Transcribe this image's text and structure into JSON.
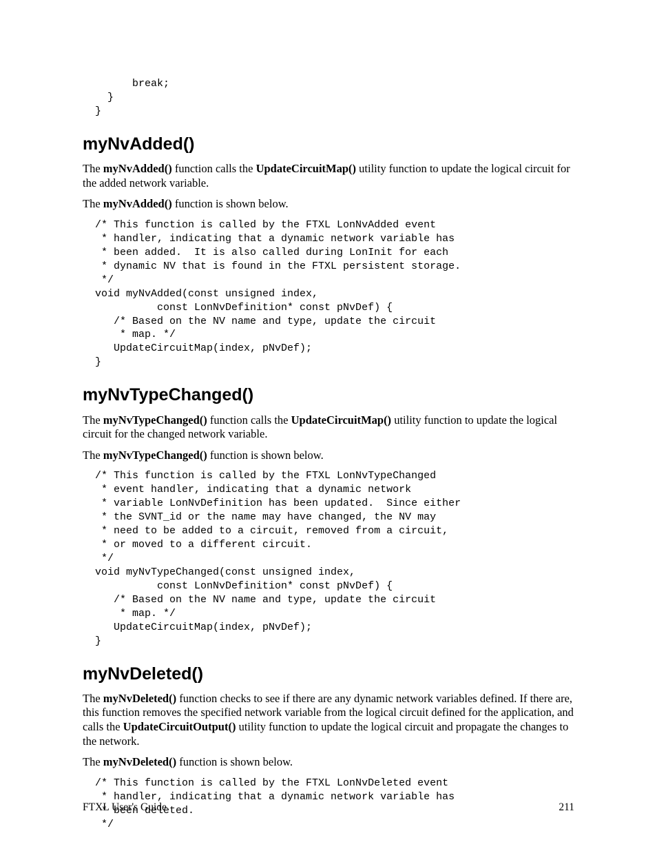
{
  "code_top": "      break;\n  }\n}",
  "section1": {
    "title": "myNvAdded()",
    "para1_prefix": "The ",
    "para1_b1": "myNvAdded()",
    "para1_mid": " function calls the ",
    "para1_b2": "UpdateCircuitMap()",
    "para1_suffix": " utility function to update the logical circuit for the added network variable.",
    "para2_prefix": "The ",
    "para2_b1": "myNvAdded()",
    "para2_suffix": " function is shown below.",
    "code": "/* This function is called by the FTXL LonNvAdded event\n * handler, indicating that a dynamic network variable has\n * been added.  It is also called during LonInit for each\n * dynamic NV that is found in the FTXL persistent storage.\n */\nvoid myNvAdded(const unsigned index,\n          const LonNvDefinition* const pNvDef) {\n   /* Based on the NV name and type, update the circuit\n    * map. */\n   UpdateCircuitMap(index, pNvDef);\n}"
  },
  "section2": {
    "title": "myNvTypeChanged()",
    "para1_prefix": "The ",
    "para1_b1": "myNvTypeChanged()",
    "para1_mid": " function calls the ",
    "para1_b2": "UpdateCircuitMap()",
    "para1_suffix": " utility function to update the logical circuit for the changed network variable.",
    "para2_prefix": "The ",
    "para2_b1": "myNvTypeChanged()",
    "para2_suffix": " function is shown below.",
    "code": "/* This function is called by the FTXL LonNvTypeChanged\n * event handler, indicating that a dynamic network\n * variable LonNvDefinition has been updated.  Since either\n * the SVNT_id or the name may have changed, the NV may\n * need to be added to a circuit, removed from a circuit,\n * or moved to a different circuit.\n */\nvoid myNvTypeChanged(const unsigned index,\n          const LonNvDefinition* const pNvDef) {\n   /* Based on the NV name and type, update the circuit\n    * map. */\n   UpdateCircuitMap(index, pNvDef);\n}"
  },
  "section3": {
    "title": "myNvDeleted()",
    "para1_prefix": "The ",
    "para1_b1": "myNvDeleted()",
    "para1_mid1": " function checks to see if there are any dynamic network variables defined.  If there are, this function removes the specified network variable from the logical circuit defined for the application, and calls the ",
    "para1_b2": "UpdateCircuitOutput()",
    "para1_suffix": " utility function to update the logical circuit and propagate the changes to the network.",
    "para2_prefix": "The ",
    "para2_b1": "myNvDeleted()",
    "para2_suffix": " function is shown below.",
    "code": "/* This function is called by the FTXL LonNvDeleted event\n * handler, indicating that a dynamic network variable has\n * been deleted.\n */"
  },
  "footer": {
    "left": "FTXL User's Guide",
    "right": "211"
  }
}
